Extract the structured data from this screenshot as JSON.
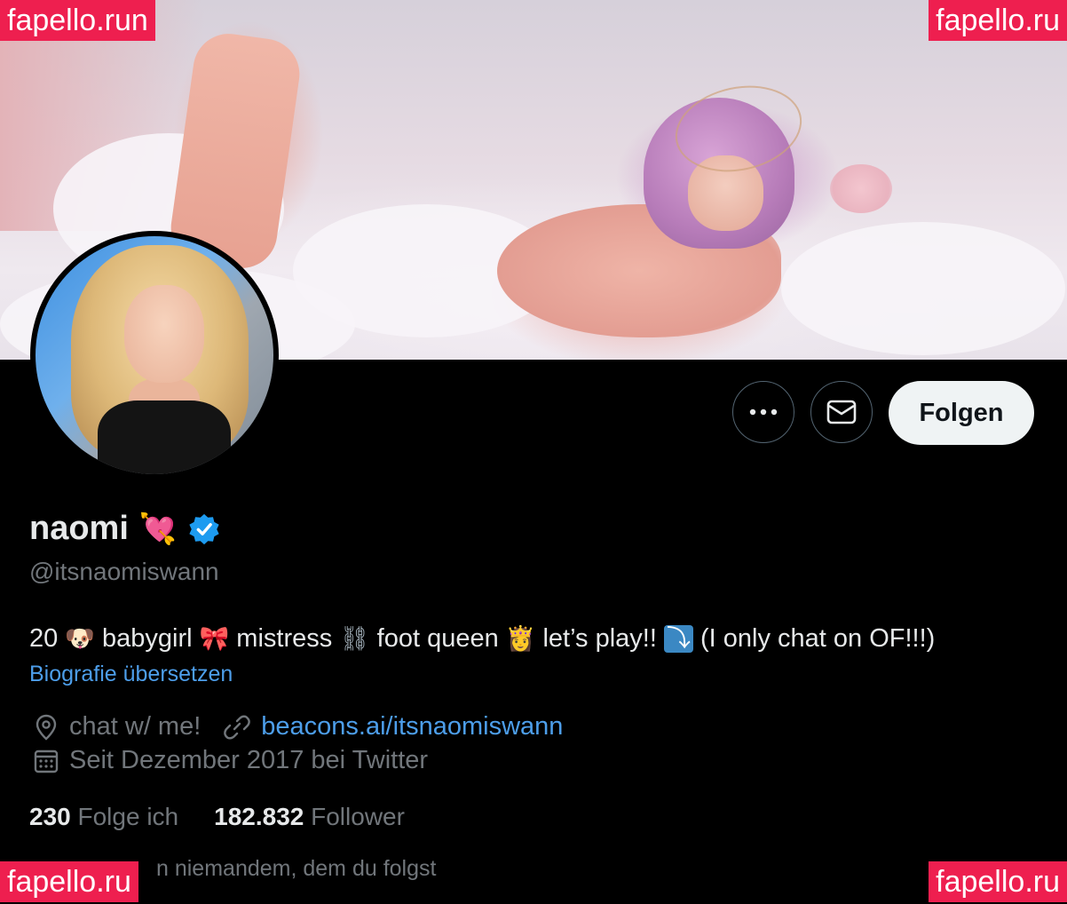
{
  "watermarks": {
    "top_left": "fapello.run",
    "top_right": "fapello.ru",
    "bottom_left": "fapello.ru",
    "bottom_right": "fapello.ru"
  },
  "actions": {
    "more_label": "•••",
    "follow_label": "Folgen"
  },
  "profile": {
    "display_name": "naomi",
    "name_emoji": "💘",
    "handle": "@itsnaomiswann",
    "bio": {
      "p1": "20 ",
      "e1": "🐶",
      "p2": " babygirl ",
      "e2": "🎀",
      "p3": " mistress ",
      "e3": "⛓",
      "p4": " foot queen ",
      "e4": "👸",
      "p5": " let’s play!! ",
      "e5": "⤵",
      "p6": " (I only chat on OF!!!)"
    },
    "translate_link": "Biografie übersetzen",
    "location": "chat w/ me!",
    "website": "beacons.ai/itsnaomiswann",
    "joined": "Seit Dezember 2017 bei Twitter"
  },
  "stats": {
    "following_count": "230",
    "following_label": "Folge ich",
    "followers_count": "182.832",
    "followers_label": "Follower"
  },
  "followed_by_text": "n niemandem, dem du folgst",
  "icons": {
    "more": "more-dots-icon",
    "message": "envelope-icon",
    "verified": "verified-badge-icon",
    "location": "location-pin-icon",
    "link": "link-icon",
    "calendar": "calendar-icon"
  },
  "colors": {
    "background": "#000000",
    "primary_text": "#e7e9ea",
    "secondary_text": "#71767b",
    "link": "#4d9eea",
    "verified": "#1d9bf0",
    "watermark": "#ee1f4f"
  }
}
